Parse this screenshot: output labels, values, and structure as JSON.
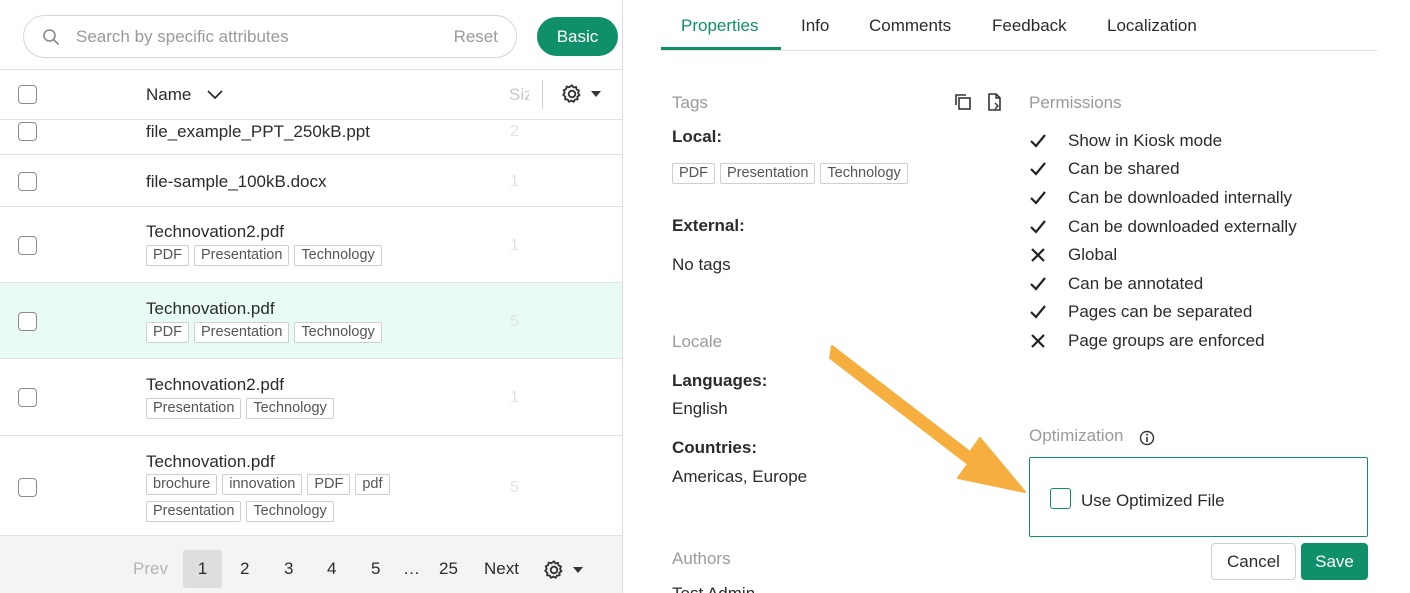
{
  "search": {
    "placeholder": "Search by specific attributes",
    "reset_label": "Reset"
  },
  "basic_label": "Basic",
  "table": {
    "header_name": "Name",
    "header_size": "Siz"
  },
  "rows": [
    {
      "name": "file_example_PPT_250kB.ppt",
      "size": "2",
      "tags": []
    },
    {
      "name": "file-sample_100kB.docx",
      "size": "1",
      "tags": []
    },
    {
      "name": "Technovation2.pdf",
      "size": "1",
      "tags": [
        "PDF",
        "Presentation",
        "Technology"
      ]
    },
    {
      "name": "Technovation.pdf",
      "size": "5",
      "tags": [
        "PDF",
        "Presentation",
        "Technology"
      ]
    },
    {
      "name": "Technovation2.pdf",
      "size": "1",
      "tags": [
        "Presentation",
        "Technology"
      ]
    },
    {
      "name": "Technovation.pdf",
      "size": "5",
      "tags": [
        "brochure",
        "innovation",
        "PDF",
        "pdf",
        "Presentation",
        "Technology"
      ]
    }
  ],
  "pager": {
    "prev": "Prev",
    "pages": [
      "1",
      "2",
      "3",
      "4",
      "5",
      "…",
      "25"
    ],
    "next": "Next"
  },
  "tabs": [
    "Properties",
    "Info",
    "Comments",
    "Feedback",
    "Localization"
  ],
  "properties": {
    "tags_title": "Tags",
    "local_label": "Local:",
    "local_tags": [
      "PDF",
      "Presentation",
      "Technology"
    ],
    "external_label": "External:",
    "external_value": "No tags",
    "locale_title": "Locale",
    "languages_label": "Languages:",
    "languages_value": "English",
    "countries_label": "Countries:",
    "countries_value": "Americas, Europe",
    "authors_title": "Authors",
    "authors_partial": "Test Admin"
  },
  "permissions": {
    "title": "Permissions",
    "items": [
      {
        "label": "Show in Kiosk mode",
        "state": "check"
      },
      {
        "label": "Can be shared",
        "state": "check"
      },
      {
        "label": "Can be downloaded internally",
        "state": "check"
      },
      {
        "label": "Can be downloaded externally",
        "state": "check"
      },
      {
        "label": "Global",
        "state": "cross"
      },
      {
        "label": "Can be annotated",
        "state": "check"
      },
      {
        "label": "Pages can be separated",
        "state": "check"
      },
      {
        "label": "Page groups are enforced",
        "state": "cross"
      }
    ]
  },
  "optimization": {
    "title": "Optimization",
    "checkbox_label": "Use Optimized File"
  },
  "actions": {
    "cancel": "Cancel",
    "save": "Save"
  },
  "colors": {
    "accent": "#0f8f6a",
    "selected_row": "#e9fbf5",
    "arrow": "#f6ae3f"
  }
}
